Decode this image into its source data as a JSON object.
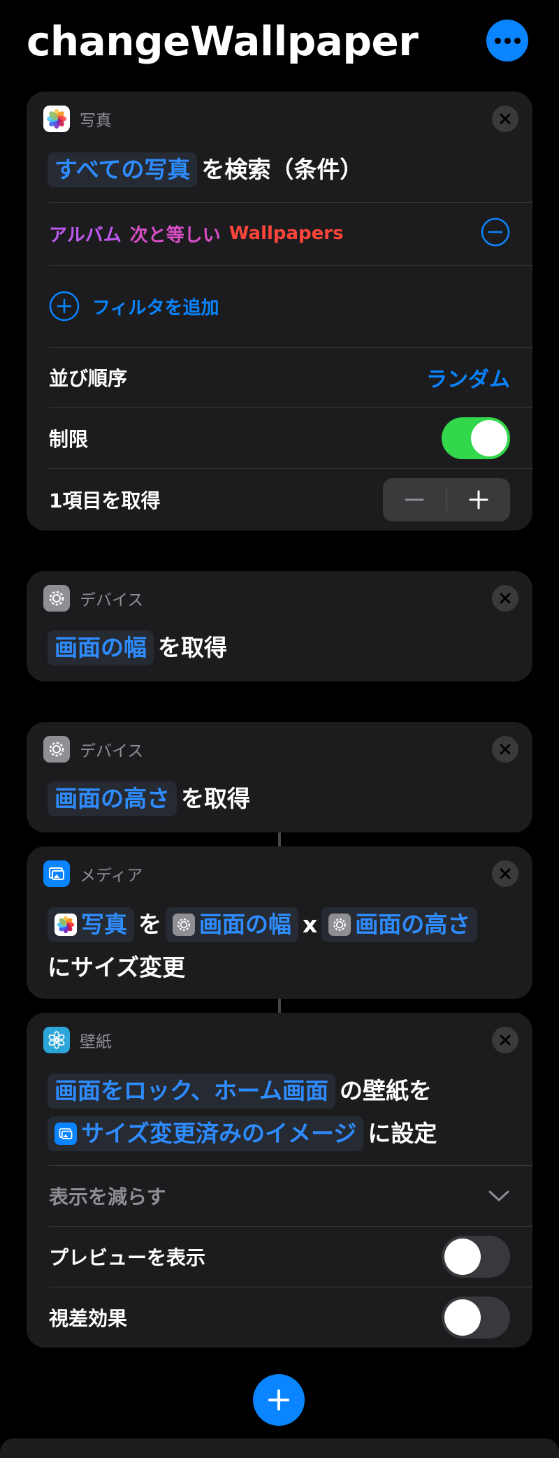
{
  "title": "changeWallpaper",
  "colors": {
    "accent": "#0a84ff",
    "card": "#1c1c1e",
    "toggle_on": "#32d74b",
    "toggle_off": "#39393d",
    "purple": "#bf5af2",
    "pink": "#da4fc9",
    "red": "#ff453a"
  },
  "cards": {
    "find_photos": {
      "app": "写真",
      "icon": "photos-icon",
      "token": "すべての写真",
      "suffix": "を検索（条件）",
      "filter": {
        "field": "アルバム",
        "op": "次と等しい",
        "value": "Wallpapers"
      },
      "add_filter": "フィルタを追加",
      "sort_label": "並び順序",
      "sort_value": "ランダム",
      "limit_label": "制限",
      "limit_on": true,
      "get_label": "1項目を取得"
    },
    "screen_width": {
      "app": "デバイス",
      "icon": "gear-icon",
      "token": "画面の幅",
      "suffix": "を取得"
    },
    "screen_height": {
      "app": "デバイス",
      "icon": "gear-icon",
      "token": "画面の高さ",
      "suffix": "を取得"
    },
    "resize": {
      "app": "メディア",
      "icon": "media-icon",
      "token_photo": "写真",
      "mid1": "を",
      "token_width": "画面の幅",
      "times": "x",
      "token_height": "画面の高さ",
      "suffix": "にサイズ変更"
    },
    "wallpaper": {
      "app": "壁紙",
      "icon": "wallpaper-icon",
      "token_target": "画面をロック、ホーム画面",
      "mid": "の壁紙を",
      "token_image": "サイズ変更済みのイメージ",
      "suffix": "に設定",
      "show_less": "表示を減らす",
      "preview_label": "プレビューを表示",
      "preview_on": false,
      "parallax_label": "視差効果",
      "parallax_on": false
    }
  }
}
